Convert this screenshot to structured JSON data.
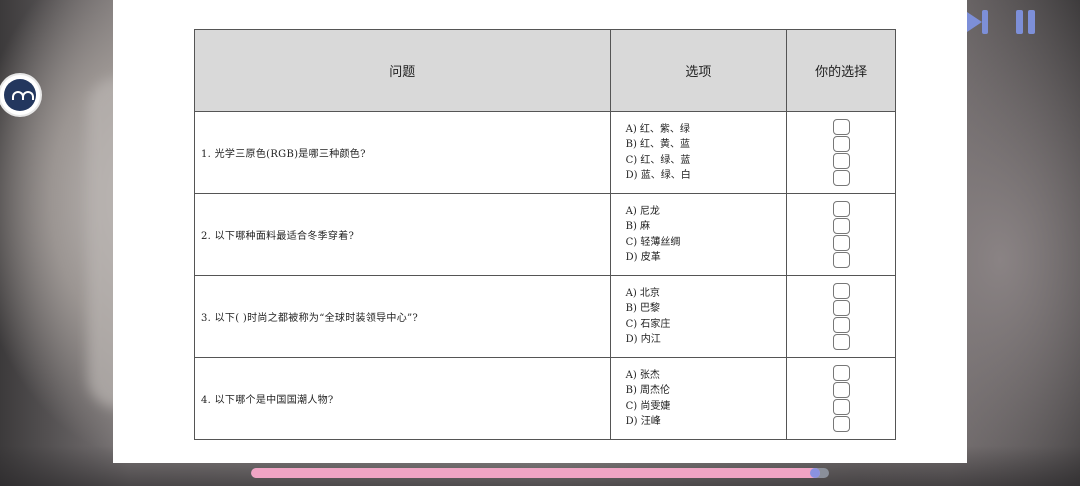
{
  "quiz": {
    "headers": {
      "question": "问题",
      "options": "选项",
      "choice": "你的选择"
    },
    "rows": [
      {
        "question": "1.  光学三原色(RGB)是哪三种颜色?",
        "options": [
          "A) 红、紫、绿",
          "B) 红、黄、蓝",
          "C) 红、绿、蓝",
          "D) 蓝、绿、白"
        ]
      },
      {
        "question": "2.  以下哪种面料最适合冬季穿着?",
        "options": [
          "A) 尼龙",
          "B) 麻",
          "C) 轻薄丝绸",
          "D) 皮革"
        ]
      },
      {
        "question": "3.  以下(  )时尚之都被称为“全球时装领导中心”?",
        "options": [
          "A) 北京",
          "B) 巴黎",
          "C) 石家庄",
          "D) 内江"
        ]
      },
      {
        "question": "4.  以下哪个是中国国潮人物?",
        "options": [
          "A) 张杰",
          "B) 周杰伦",
          "C) 尚雯婕",
          "D) 汪峰"
        ]
      }
    ]
  },
  "player": {
    "progress": 0.985,
    "colors": {
      "accent": "#7d8fd8",
      "progress_fill": "#f0a4c4",
      "progress_track": "#8a8f9a"
    },
    "icons": [
      "next-icon",
      "pause-icon",
      "avatar"
    ]
  }
}
